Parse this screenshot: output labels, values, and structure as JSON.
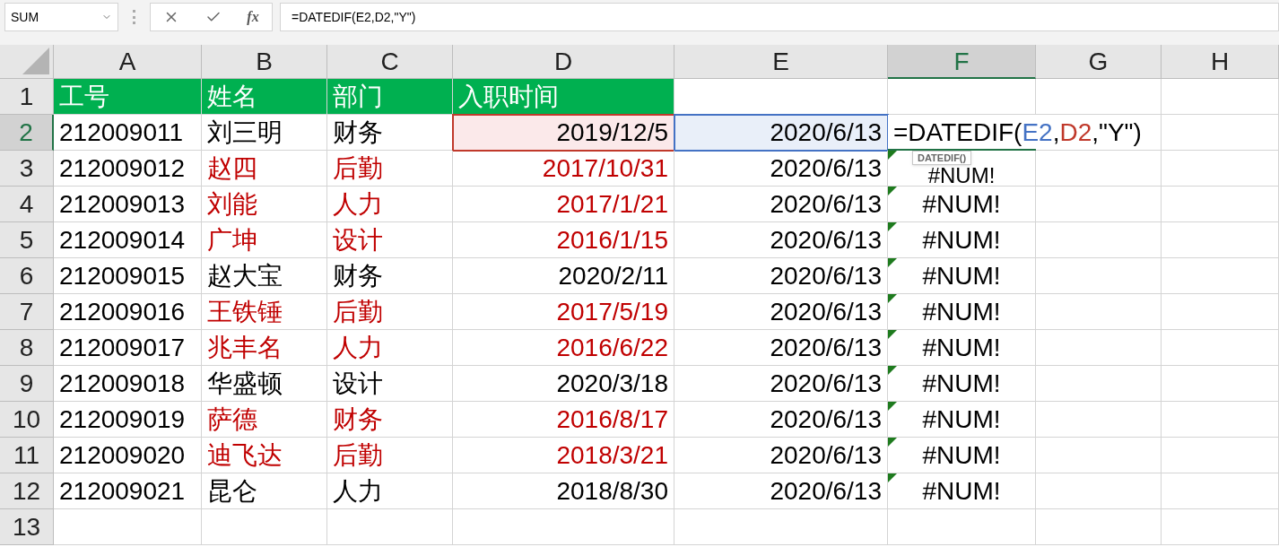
{
  "name_box": {
    "value": "SUM"
  },
  "formula_bar": {
    "fx_label": "fx",
    "value": "=DATEDIF(E2,D2,\"Y\")"
  },
  "columns": [
    {
      "label": "A",
      "selected": false
    },
    {
      "label": "B",
      "selected": false
    },
    {
      "label": "C",
      "selected": false
    },
    {
      "label": "D",
      "selected": false
    },
    {
      "label": "E",
      "selected": false
    },
    {
      "label": "F",
      "selected": true
    },
    {
      "label": "G",
      "selected": false
    },
    {
      "label": "H",
      "selected": false
    }
  ],
  "header_row": {
    "number": "1",
    "selected": false,
    "cells": [
      "工号",
      "姓名",
      "部门",
      "入职时间"
    ]
  },
  "rows": [
    {
      "number": "2",
      "selected": true,
      "id": "212009011",
      "name": "刘三明",
      "dept": "财务",
      "hire_date": "2019/12/5",
      "today": "2020/6/13",
      "red": false,
      "error_flag": false,
      "formula": [
        {
          "text": "=DATEDIF(",
          "color": "#000000"
        },
        {
          "text": "E2",
          "color": "#4472c4"
        },
        {
          "text": ",",
          "color": "#000000"
        },
        {
          "text": "D2",
          "color": "#c0392b"
        },
        {
          "text": ",\"Y\")",
          "color": "#000000"
        }
      ],
      "tooltip": "DATEDIF()"
    },
    {
      "number": "3",
      "selected": false,
      "id": "212009012",
      "name": "赵四",
      "dept": "后勤",
      "hire_date": "2017/10/31",
      "today": "2020/6/13",
      "red": true,
      "error_flag": true,
      "result": "#NUM!"
    },
    {
      "number": "4",
      "selected": false,
      "id": "212009013",
      "name": "刘能",
      "dept": "人力",
      "hire_date": "2017/1/21",
      "today": "2020/6/13",
      "red": true,
      "error_flag": true,
      "result": "#NUM!"
    },
    {
      "number": "5",
      "selected": false,
      "id": "212009014",
      "name": "广坤",
      "dept": "设计",
      "hire_date": "2016/1/15",
      "today": "2020/6/13",
      "red": true,
      "error_flag": true,
      "result": "#NUM!"
    },
    {
      "number": "6",
      "selected": false,
      "id": "212009015",
      "name": "赵大宝",
      "dept": "财务",
      "hire_date": "2020/2/11",
      "today": "2020/6/13",
      "red": false,
      "error_flag": true,
      "result": "#NUM!"
    },
    {
      "number": "7",
      "selected": false,
      "id": "212009016",
      "name": "王铁锤",
      "dept": "后勤",
      "hire_date": "2017/5/19",
      "today": "2020/6/13",
      "red": true,
      "error_flag": true,
      "result": "#NUM!"
    },
    {
      "number": "8",
      "selected": false,
      "id": "212009017",
      "name": "兆丰名",
      "dept": "人力",
      "hire_date": "2016/6/22",
      "today": "2020/6/13",
      "red": true,
      "error_flag": true,
      "result": "#NUM!"
    },
    {
      "number": "9",
      "selected": false,
      "id": "212009018",
      "name": "华盛顿",
      "dept": "设计",
      "hire_date": "2020/3/18",
      "today": "2020/6/13",
      "red": false,
      "error_flag": true,
      "result": "#NUM!"
    },
    {
      "number": "10",
      "selected": false,
      "id": "212009019",
      "name": "萨德",
      "dept": "财务",
      "hire_date": "2016/8/17",
      "today": "2020/6/13",
      "red": true,
      "error_flag": true,
      "result": "#NUM!"
    },
    {
      "number": "11",
      "selected": false,
      "id": "212009020",
      "name": "迪飞达",
      "dept": "后勤",
      "hire_date": "2018/3/21",
      "today": "2020/6/13",
      "red": true,
      "error_flag": true,
      "result": "#NUM!"
    },
    {
      "number": "12",
      "selected": false,
      "id": "212009021",
      "name": "昆仑",
      "dept": "人力",
      "hire_date": "2018/8/30",
      "today": "2020/6/13",
      "red": false,
      "error_flag": true,
      "result": "#NUM!"
    }
  ],
  "empty_rows": [
    "13"
  ]
}
